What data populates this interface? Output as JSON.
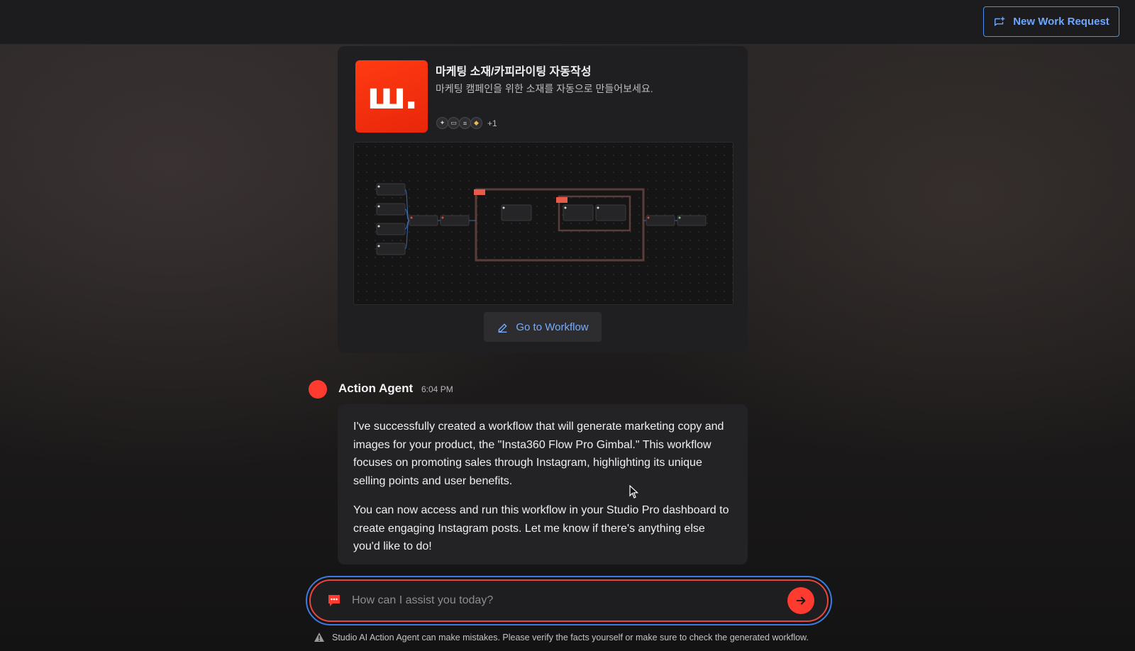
{
  "header": {
    "new_request_label": "New Work Request",
    "accent_color": "#4d8ef0"
  },
  "workflow_card": {
    "title": "마케팅 소재/카피라이팅 자동작성",
    "description": "마케팅 캠페인을 위한 소재를 자동으로 만들어보세요.",
    "logo_text": "ш.",
    "logo_color": "#ff3b12",
    "tool_icons": [
      "sparkle-icon",
      "keyboard-icon",
      "filter-icon",
      "tag-icon"
    ],
    "tool_more": "+1",
    "goto_label": "Go to Workflow"
  },
  "message": {
    "sender": "Action Agent",
    "time": "6:04 PM",
    "paragraph_1": "I've successfully created a workflow that will generate marketing copy and images for your product, the \"Insta360 Flow Pro Gimbal.\" This workflow focuses on promoting sales through Instagram, highlighting its unique selling points and user benefits.",
    "paragraph_2": "You can now access and run this workflow in your Studio Pro dashboard to create engaging Instagram posts. Let me know if there's anything else you'd like to do!"
  },
  "composer": {
    "placeholder": "How can I assist you today?",
    "value": "",
    "send_color": "#ff3b30"
  },
  "footer": {
    "disclaimer": "Studio AI Action Agent can make mistakes. Please verify the facts yourself or make sure to check the generated workflow."
  }
}
